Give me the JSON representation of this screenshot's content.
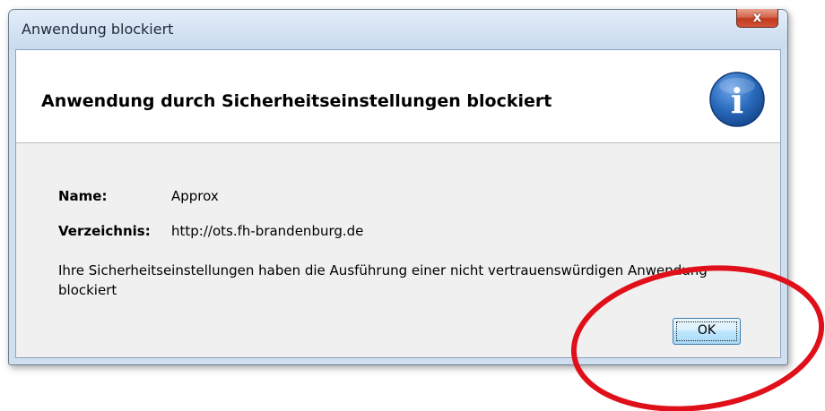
{
  "window": {
    "title": "Anwendung blockiert",
    "close_glyph": "x"
  },
  "header": {
    "heading": "Anwendung durch Sicherheitseinstellungen blockiert",
    "icon": "info-icon",
    "icon_glyph": "i"
  },
  "details": {
    "name_label": "Name:",
    "name_value": "Approx",
    "directory_label": "Verzeichnis:",
    "directory_value": "http://ots.fh-brandenburg.de"
  },
  "message": "Ihre Sicherheitseinstellungen haben die Ausführung einer nicht vertrauenswürdigen Anwendung blockiert",
  "buttons": {
    "ok_label": "OK"
  },
  "annotation": {
    "shape": "ellipse",
    "color": "#e0101a"
  },
  "colors": {
    "titlebar": "#d3e2f2",
    "close_button": "#c2391d",
    "info_icon": "#2a6bbd",
    "dialog_body": "#f0f0f0"
  }
}
